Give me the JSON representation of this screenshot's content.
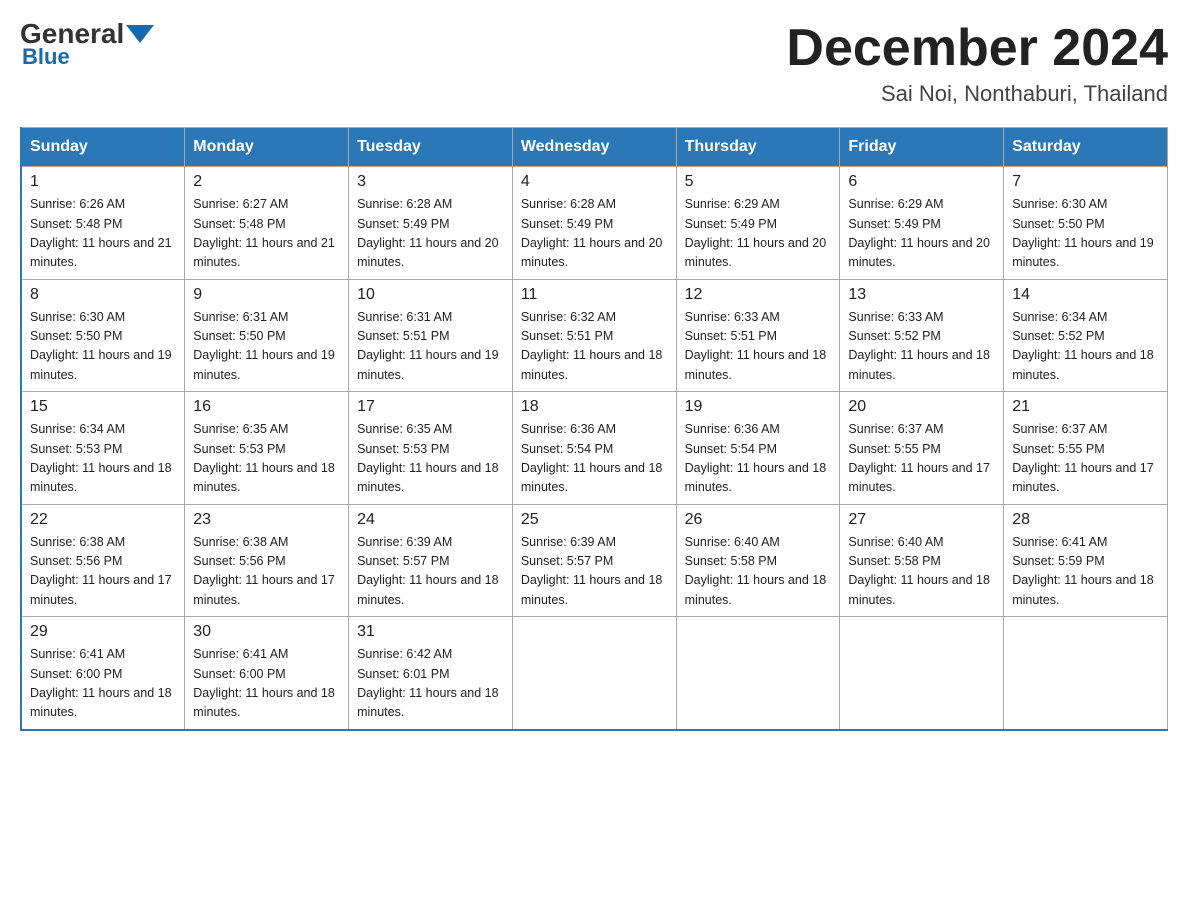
{
  "header": {
    "logo": {
      "general": "General",
      "blue": "Blue"
    },
    "title": "December 2024",
    "location": "Sai Noi, Nonthaburi, Thailand"
  },
  "columns": [
    "Sunday",
    "Monday",
    "Tuesday",
    "Wednesday",
    "Thursday",
    "Friday",
    "Saturday"
  ],
  "weeks": [
    [
      {
        "day": "1",
        "sunrise": "Sunrise: 6:26 AM",
        "sunset": "Sunset: 5:48 PM",
        "daylight": "Daylight: 11 hours and 21 minutes."
      },
      {
        "day": "2",
        "sunrise": "Sunrise: 6:27 AM",
        "sunset": "Sunset: 5:48 PM",
        "daylight": "Daylight: 11 hours and 21 minutes."
      },
      {
        "day": "3",
        "sunrise": "Sunrise: 6:28 AM",
        "sunset": "Sunset: 5:49 PM",
        "daylight": "Daylight: 11 hours and 20 minutes."
      },
      {
        "day": "4",
        "sunrise": "Sunrise: 6:28 AM",
        "sunset": "Sunset: 5:49 PM",
        "daylight": "Daylight: 11 hours and 20 minutes."
      },
      {
        "day": "5",
        "sunrise": "Sunrise: 6:29 AM",
        "sunset": "Sunset: 5:49 PM",
        "daylight": "Daylight: 11 hours and 20 minutes."
      },
      {
        "day": "6",
        "sunrise": "Sunrise: 6:29 AM",
        "sunset": "Sunset: 5:49 PM",
        "daylight": "Daylight: 11 hours and 20 minutes."
      },
      {
        "day": "7",
        "sunrise": "Sunrise: 6:30 AM",
        "sunset": "Sunset: 5:50 PM",
        "daylight": "Daylight: 11 hours and 19 minutes."
      }
    ],
    [
      {
        "day": "8",
        "sunrise": "Sunrise: 6:30 AM",
        "sunset": "Sunset: 5:50 PM",
        "daylight": "Daylight: 11 hours and 19 minutes."
      },
      {
        "day": "9",
        "sunrise": "Sunrise: 6:31 AM",
        "sunset": "Sunset: 5:50 PM",
        "daylight": "Daylight: 11 hours and 19 minutes."
      },
      {
        "day": "10",
        "sunrise": "Sunrise: 6:31 AM",
        "sunset": "Sunset: 5:51 PM",
        "daylight": "Daylight: 11 hours and 19 minutes."
      },
      {
        "day": "11",
        "sunrise": "Sunrise: 6:32 AM",
        "sunset": "Sunset: 5:51 PM",
        "daylight": "Daylight: 11 hours and 18 minutes."
      },
      {
        "day": "12",
        "sunrise": "Sunrise: 6:33 AM",
        "sunset": "Sunset: 5:51 PM",
        "daylight": "Daylight: 11 hours and 18 minutes."
      },
      {
        "day": "13",
        "sunrise": "Sunrise: 6:33 AM",
        "sunset": "Sunset: 5:52 PM",
        "daylight": "Daylight: 11 hours and 18 minutes."
      },
      {
        "day": "14",
        "sunrise": "Sunrise: 6:34 AM",
        "sunset": "Sunset: 5:52 PM",
        "daylight": "Daylight: 11 hours and 18 minutes."
      }
    ],
    [
      {
        "day": "15",
        "sunrise": "Sunrise: 6:34 AM",
        "sunset": "Sunset: 5:53 PM",
        "daylight": "Daylight: 11 hours and 18 minutes."
      },
      {
        "day": "16",
        "sunrise": "Sunrise: 6:35 AM",
        "sunset": "Sunset: 5:53 PM",
        "daylight": "Daylight: 11 hours and 18 minutes."
      },
      {
        "day": "17",
        "sunrise": "Sunrise: 6:35 AM",
        "sunset": "Sunset: 5:53 PM",
        "daylight": "Daylight: 11 hours and 18 minutes."
      },
      {
        "day": "18",
        "sunrise": "Sunrise: 6:36 AM",
        "sunset": "Sunset: 5:54 PM",
        "daylight": "Daylight: 11 hours and 18 minutes."
      },
      {
        "day": "19",
        "sunrise": "Sunrise: 6:36 AM",
        "sunset": "Sunset: 5:54 PM",
        "daylight": "Daylight: 11 hours and 18 minutes."
      },
      {
        "day": "20",
        "sunrise": "Sunrise: 6:37 AM",
        "sunset": "Sunset: 5:55 PM",
        "daylight": "Daylight: 11 hours and 17 minutes."
      },
      {
        "day": "21",
        "sunrise": "Sunrise: 6:37 AM",
        "sunset": "Sunset: 5:55 PM",
        "daylight": "Daylight: 11 hours and 17 minutes."
      }
    ],
    [
      {
        "day": "22",
        "sunrise": "Sunrise: 6:38 AM",
        "sunset": "Sunset: 5:56 PM",
        "daylight": "Daylight: 11 hours and 17 minutes."
      },
      {
        "day": "23",
        "sunrise": "Sunrise: 6:38 AM",
        "sunset": "Sunset: 5:56 PM",
        "daylight": "Daylight: 11 hours and 17 minutes."
      },
      {
        "day": "24",
        "sunrise": "Sunrise: 6:39 AM",
        "sunset": "Sunset: 5:57 PM",
        "daylight": "Daylight: 11 hours and 18 minutes."
      },
      {
        "day": "25",
        "sunrise": "Sunrise: 6:39 AM",
        "sunset": "Sunset: 5:57 PM",
        "daylight": "Daylight: 11 hours and 18 minutes."
      },
      {
        "day": "26",
        "sunrise": "Sunrise: 6:40 AM",
        "sunset": "Sunset: 5:58 PM",
        "daylight": "Daylight: 11 hours and 18 minutes."
      },
      {
        "day": "27",
        "sunrise": "Sunrise: 6:40 AM",
        "sunset": "Sunset: 5:58 PM",
        "daylight": "Daylight: 11 hours and 18 minutes."
      },
      {
        "day": "28",
        "sunrise": "Sunrise: 6:41 AM",
        "sunset": "Sunset: 5:59 PM",
        "daylight": "Daylight: 11 hours and 18 minutes."
      }
    ],
    [
      {
        "day": "29",
        "sunrise": "Sunrise: 6:41 AM",
        "sunset": "Sunset: 6:00 PM",
        "daylight": "Daylight: 11 hours and 18 minutes."
      },
      {
        "day": "30",
        "sunrise": "Sunrise: 6:41 AM",
        "sunset": "Sunset: 6:00 PM",
        "daylight": "Daylight: 11 hours and 18 minutes."
      },
      {
        "day": "31",
        "sunrise": "Sunrise: 6:42 AM",
        "sunset": "Sunset: 6:01 PM",
        "daylight": "Daylight: 11 hours and 18 minutes."
      },
      null,
      null,
      null,
      null
    ]
  ]
}
